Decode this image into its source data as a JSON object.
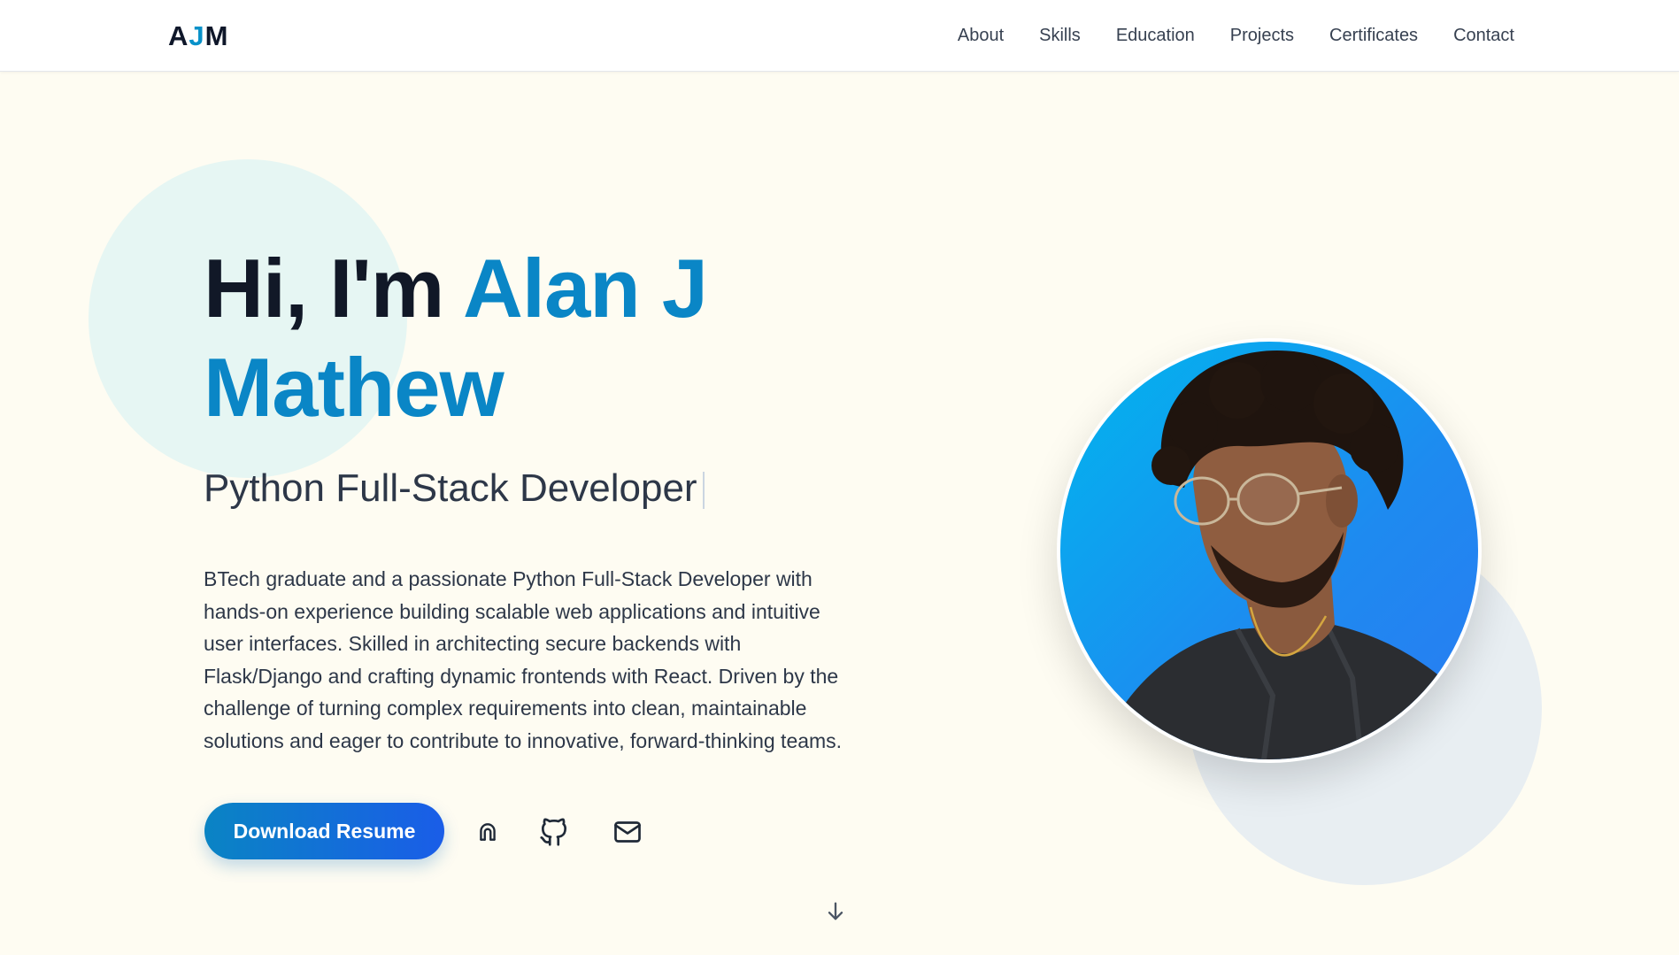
{
  "header": {
    "logo": {
      "part1": "A",
      "part2": "J",
      "part3": "M"
    },
    "nav": [
      "About",
      "Skills",
      "Education",
      "Projects",
      "Certificates",
      "Contact"
    ]
  },
  "hero": {
    "greeting": "Hi, I'm",
    "name": "Alan J Mathew",
    "role": "Python Full-Stack Developer",
    "bio": "BTech graduate and a passionate Python Full-Stack Developer with hands-on experience building scalable web applications and intuitive user interfaces. Skilled in architecting secure backends with Flask/Django and crafting dynamic frontends with React. Driven by the challenge of turning complex requirements into clean, maintainable solutions and eager to contribute to innovative, forward-thinking teams.",
    "download_label": "Download Resume"
  },
  "social": {
    "icons": [
      "magnet-icon",
      "github-icon",
      "mail-icon"
    ]
  },
  "colors": {
    "accent": "#0a86c6",
    "background": "#fefcf2",
    "button_gradient_start": "#0a84c4",
    "button_gradient_end": "#1a5de8",
    "portrait_bg": "#00b6ee"
  }
}
